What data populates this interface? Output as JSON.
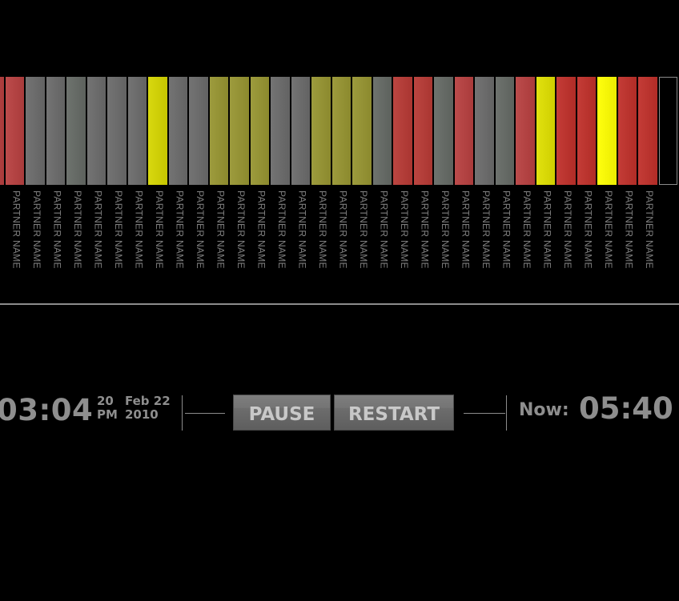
{
  "partners": [
    {
      "name": "PARTNER NAME",
      "color": "#b84040"
    },
    {
      "name": "PARTNER NAME",
      "color": "#b84040"
    },
    {
      "name": "PARTNER NAME",
      "color": "#6b6b6b"
    },
    {
      "name": "PARTNER NAME",
      "color": "#6b6b6b"
    },
    {
      "name": "PARTNER NAME",
      "color": "#656a65"
    },
    {
      "name": "PARTNER NAME",
      "color": "#6b6b6b"
    },
    {
      "name": "PARTNER NAME",
      "color": "#6b6b6b"
    },
    {
      "name": "PARTNER NAME",
      "color": "#6b6b6b"
    },
    {
      "name": "PARTNER NAME",
      "color": "#d6d600"
    },
    {
      "name": "PARTNER NAME",
      "color": "#6b6b6b"
    },
    {
      "name": "PARTNER NAME",
      "color": "#6b6b6b"
    },
    {
      "name": "PARTNER NAME",
      "color": "#979531"
    },
    {
      "name": "PARTNER NAME",
      "color": "#979531"
    },
    {
      "name": "PARTNER NAME",
      "color": "#979531"
    },
    {
      "name": "PARTNER NAME",
      "color": "#6b6b6b"
    },
    {
      "name": "PARTNER NAME",
      "color": "#6b6b6b"
    },
    {
      "name": "PARTNER NAME",
      "color": "#979531"
    },
    {
      "name": "PARTNER NAME",
      "color": "#979531"
    },
    {
      "name": "PARTNER NAME",
      "color": "#979531"
    },
    {
      "name": "PARTNER NAME",
      "color": "#656a65"
    },
    {
      "name": "PARTNER NAME",
      "color": "#b83a35"
    },
    {
      "name": "PARTNER NAME",
      "color": "#b83a35"
    },
    {
      "name": "PARTNER NAME",
      "color": "#656a65"
    },
    {
      "name": "PARTNER NAME",
      "color": "#b84040"
    },
    {
      "name": "PARTNER NAME",
      "color": "#6b6b6b"
    },
    {
      "name": "PARTNER NAME",
      "color": "#656a65"
    },
    {
      "name": "PARTNER NAME",
      "color": "#b84040"
    },
    {
      "name": "PARTNER NAME",
      "color": "#e0e000"
    },
    {
      "name": "PARTNER NAME",
      "color": "#c0302a"
    },
    {
      "name": "PARTNER NAME",
      "color": "#c0302a"
    },
    {
      "name": "PARTNER NAME",
      "color": "#ffff00"
    },
    {
      "name": "PARTNER NAME",
      "color": "#c0302a"
    },
    {
      "name": "PARTNER NAME",
      "color": "#c0302a"
    },
    {
      "name": "",
      "color": "#000000",
      "empty": true
    }
  ],
  "playback": {
    "time": "03:04",
    "seconds": "20",
    "ampm": "PM",
    "month_day": "Feb 22",
    "year": "2010"
  },
  "controls": {
    "pause_label": "PAUSE",
    "restart_label": "RESTART"
  },
  "now": {
    "label": "Now:",
    "time": "05:40"
  }
}
